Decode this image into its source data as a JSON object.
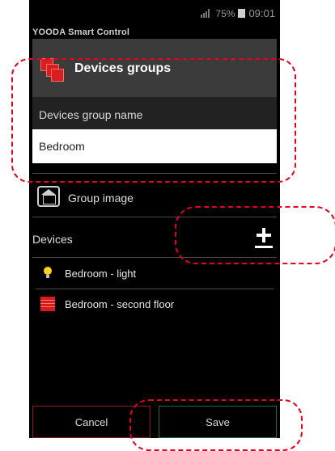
{
  "status_bar": {
    "battery": "75%",
    "time": "09:01"
  },
  "app_title": "YOODA Smart Control",
  "header": {
    "title": "Devices groups"
  },
  "group_name": {
    "label": "Devices group name",
    "value": "Bedroom"
  },
  "group_image": {
    "label": "Group image"
  },
  "devices": {
    "label": "Devices",
    "items": [
      {
        "name": "Bedroom - light",
        "icon": "bulb-icon"
      },
      {
        "name": "Bedroom - second floor",
        "icon": "blind-icon"
      }
    ]
  },
  "buttons": {
    "cancel": "Cancel",
    "save": "Save"
  },
  "colors": {
    "annotation": "#e4001e",
    "header_bg": "#3b3b3b",
    "accent_red": "#d81e1e",
    "save_border": "#1f6b52",
    "cancel_border": "#8b1c1c"
  }
}
